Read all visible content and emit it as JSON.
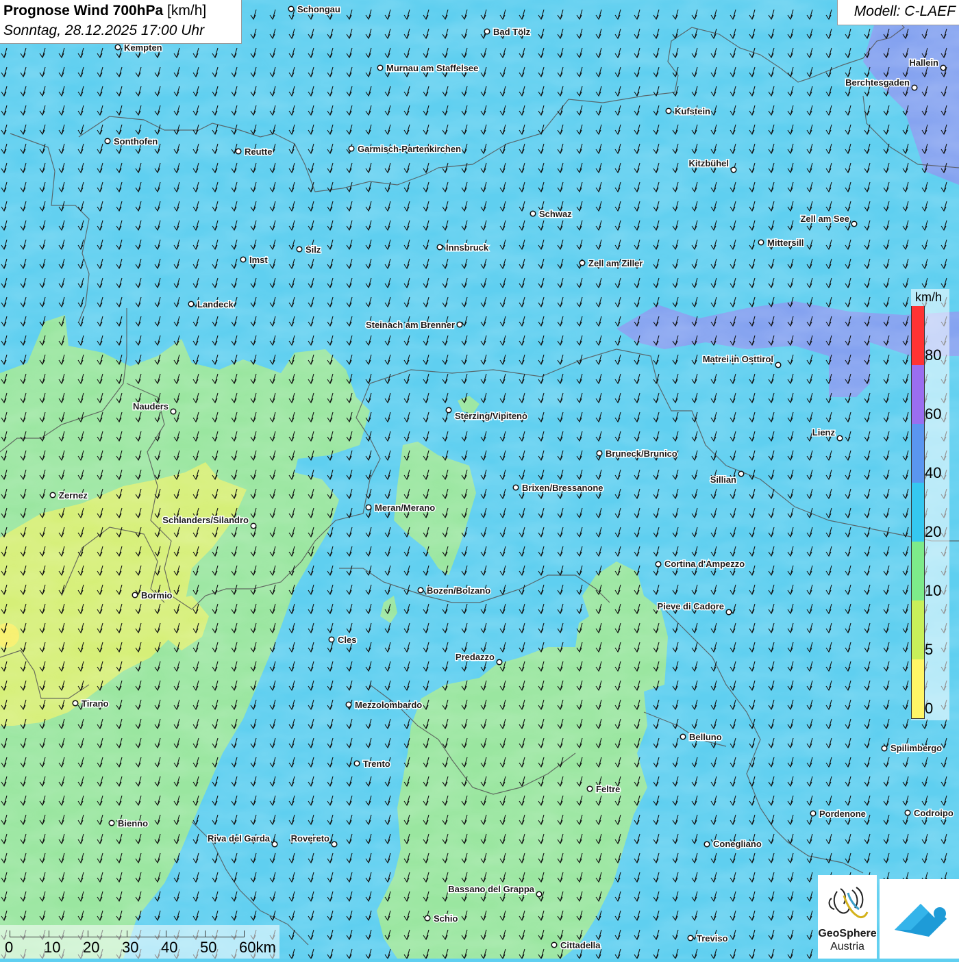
{
  "title": {
    "main": "Prognose Wind 700hPa",
    "unit": "[km/h]",
    "datetime": "Sonntag, 28.12.2025 17:00 Uhr"
  },
  "model": "Modell: C-LAEF",
  "legend": {
    "unit": "km/h",
    "classes": [
      {
        "from": 0,
        "to": 5,
        "color": "#fff666"
      },
      {
        "from": 5,
        "to": 10,
        "color": "#c8f05a"
      },
      {
        "from": 10,
        "to": 20,
        "color": "#7deb8a"
      },
      {
        "from": 20,
        "to": 40,
        "color": "#35c8f0"
      },
      {
        "from": 40,
        "to": 60,
        "color": "#5a96f0"
      },
      {
        "from": 60,
        "to": 80,
        "color": "#9a6ef0"
      },
      {
        "from": 80,
        "to": 100,
        "color": "#ff3333"
      }
    ],
    "tick_labels": [
      "0",
      "5",
      "10",
      "20",
      "40",
      "60",
      "80"
    ]
  },
  "scalebar": {
    "labels": [
      "0",
      "10",
      "20",
      "30",
      "40",
      "50",
      "60km"
    ]
  },
  "wind_direction": "from north-northeast (arrows pointing south-southwest)",
  "field_colors": {
    "base": "#5fcff0",
    "low_wind": "#9ae6a0",
    "calm": "#d6ef78",
    "strong": "#8b9af0"
  },
  "cities": [
    {
      "name": "Schongau"
    },
    {
      "name": "Bad Tölz"
    },
    {
      "name": "Kempten"
    },
    {
      "name": "Hallein"
    },
    {
      "name": "Murnau am Staffelsee"
    },
    {
      "name": "Berchtesgaden"
    },
    {
      "name": "Kufstein"
    },
    {
      "name": "Sonthofen"
    },
    {
      "name": "Garmisch-Partenkirchen"
    },
    {
      "name": "Reutte"
    },
    {
      "name": "Kitzbühel"
    },
    {
      "name": "Schwaz"
    },
    {
      "name": "Zell am See"
    },
    {
      "name": "Mittersill"
    },
    {
      "name": "Silz"
    },
    {
      "name": "Innsbruck"
    },
    {
      "name": "Imst"
    },
    {
      "name": "Zell am Ziller"
    },
    {
      "name": "Landeck"
    },
    {
      "name": "Steinach am Brenner"
    },
    {
      "name": "Matrei in Osttirol"
    },
    {
      "name": "Nauders"
    },
    {
      "name": "Sterzing/Vipiteno"
    },
    {
      "name": "Lienz"
    },
    {
      "name": "Bruneck/Brunico"
    },
    {
      "name": "Sillian"
    },
    {
      "name": "Brixen/Bressanone"
    },
    {
      "name": "Zernez"
    },
    {
      "name": "Meran/Merano"
    },
    {
      "name": "Schlanders/Silandro"
    },
    {
      "name": "Cortina d'Ampezzo"
    },
    {
      "name": "Bozen/Bolzano"
    },
    {
      "name": "Bormio"
    },
    {
      "name": "Pieve di Cadore"
    },
    {
      "name": "Cles"
    },
    {
      "name": "Predazzo"
    },
    {
      "name": "Tirano"
    },
    {
      "name": "Mezzolombardo"
    },
    {
      "name": "Belluno"
    },
    {
      "name": "Spilimbergo"
    },
    {
      "name": "Trento"
    },
    {
      "name": "Feltre"
    },
    {
      "name": "Pordenone"
    },
    {
      "name": "Codroipo"
    },
    {
      "name": "Bienno"
    },
    {
      "name": "Riva del Garda"
    },
    {
      "name": "Rovereto"
    },
    {
      "name": "Conegliano"
    },
    {
      "name": "Bassano del Grappa"
    },
    {
      "name": "Schio"
    },
    {
      "name": "Treviso"
    },
    {
      "name": "Cittadella"
    }
  ],
  "logos": {
    "geosphere_name": "GeoSphere",
    "geosphere_sub": "Austria",
    "app": "cloud-app-icon"
  }
}
